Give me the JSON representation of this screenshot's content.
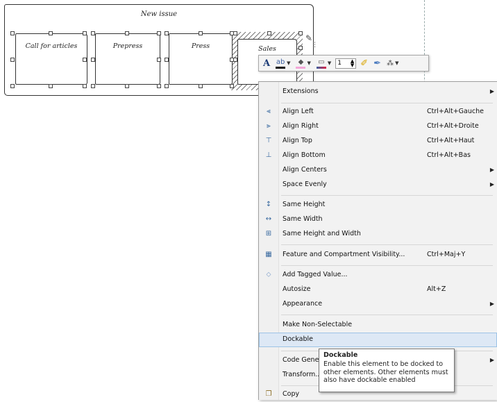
{
  "diagram": {
    "title": "New issue",
    "boxes": [
      "Call for articles",
      "Prepress",
      "Press",
      "Sales"
    ]
  },
  "toolbar": {
    "font_icon": "A",
    "spin_value": "1",
    "icons": [
      "font-icon",
      "text-color-icon",
      "fill-color-icon",
      "line-color-icon",
      "line-width-spinner",
      "format-painter-icon",
      "eyedropper-icon",
      "layout-icon"
    ]
  },
  "menu": {
    "items": [
      {
        "label": "Extensions",
        "shortcut": "",
        "submenu": true
      },
      {
        "label": "Align Left",
        "shortcut": "Ctrl+Alt+Gauche",
        "submenu": false
      },
      {
        "label": "Align Right",
        "shortcut": "Ctrl+Alt+Droite",
        "submenu": false
      },
      {
        "label": "Align Top",
        "shortcut": "Ctrl+Alt+Haut",
        "submenu": false
      },
      {
        "label": "Align Bottom",
        "shortcut": "Ctrl+Alt+Bas",
        "submenu": false
      },
      {
        "label": "Align Centers",
        "shortcut": "",
        "submenu": true
      },
      {
        "label": "Space Evenly",
        "shortcut": "",
        "submenu": true
      },
      {
        "label": "Same Height",
        "shortcut": "",
        "submenu": false
      },
      {
        "label": "Same Width",
        "shortcut": "",
        "submenu": false
      },
      {
        "label": "Same Height and Width",
        "shortcut": "",
        "submenu": false
      },
      {
        "label": "Feature and Compartment Visibility...",
        "shortcut": "Ctrl+Maj+Y",
        "submenu": false
      },
      {
        "label": "Add Tagged Value...",
        "shortcut": "",
        "submenu": false
      },
      {
        "label": "Autosize",
        "shortcut": "Alt+Z",
        "submenu": false
      },
      {
        "label": "Appearance",
        "shortcut": "",
        "submenu": true
      },
      {
        "label": "Make Non-Selectable",
        "shortcut": "",
        "submenu": false
      },
      {
        "label": "Dockable",
        "shortcut": "",
        "submenu": false,
        "highlighted": true
      },
      {
        "label": "Code Gene",
        "shortcut": "",
        "submenu": true
      },
      {
        "label": "Transform...",
        "shortcut": "",
        "submenu": false
      },
      {
        "label": "Copy",
        "shortcut": "",
        "submenu": false
      }
    ]
  },
  "tooltip": {
    "title": "Dockable",
    "lines": [
      "Enable this element to be docked to",
      "other elements. Other elements must",
      "also have dockable enabled"
    ]
  },
  "colors": {
    "highlight": "#dde8f5",
    "highlight_border": "#9cc3e6",
    "menu_bg": "#f2f2f2"
  }
}
